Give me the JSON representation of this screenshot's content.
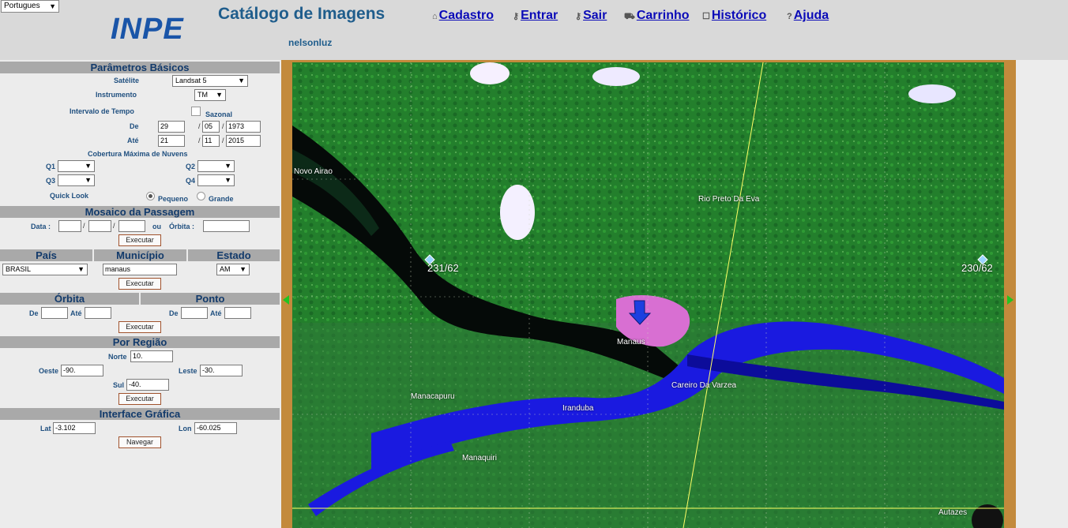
{
  "header": {
    "language": "Portugues",
    "logo": "INPE",
    "title": "Catálogo de Imagens",
    "user": "nelsonluz",
    "nav": [
      "Cadastro",
      "Entrar",
      "Sair",
      "Carrinho",
      "Histórico",
      "Ajuda"
    ]
  },
  "basic": {
    "title": "Parâmetros Básicos",
    "satellite_label": "Satélite",
    "satellite_value": "Landsat 5",
    "instrument_label": "Instrumento",
    "instrument_value": "TM",
    "interval_label": "Intervalo de Tempo",
    "seasonal_label": "Sazonal",
    "from_label": "De",
    "from_day": "29",
    "from_month": "05",
    "from_year": "1973",
    "to_label": "Até",
    "to_day": "21",
    "to_month": "11",
    "to_year": "2015",
    "clouds_label": "Cobertura Máxima de Nuvens",
    "q1": "Q1",
    "q2": "Q2",
    "q3": "Q3",
    "q4": "Q4",
    "quicklook_label": "Quick Look",
    "small": "Pequeno",
    "large": "Grande"
  },
  "mosaic": {
    "title": "Mosaico da Passagem",
    "date_label": "Data :",
    "or_label": "ou",
    "orbit_label": "Órbita :",
    "execute": "Executar"
  },
  "location": {
    "country_label": "País",
    "city_label": "Município",
    "state_label": "Estado",
    "country_value": "BRASIL",
    "city_value": "manaus",
    "state_value": "AM",
    "execute": "Executar"
  },
  "orbit": {
    "orbit_label": "Órbita",
    "point_label": "Ponto",
    "from_label": "De",
    "to_label": "Até",
    "from2_label": "De",
    "to2_label": "Até",
    "execute": "Executar"
  },
  "region": {
    "title": "Por Região",
    "north_label": "Norte",
    "north_value": "10.",
    "west_label": "Oeste",
    "west_value": "-90.",
    "east_label": "Leste",
    "east_value": "-30.",
    "south_label": "Sul",
    "south_value": "-40.",
    "execute": "Executar"
  },
  "graphic": {
    "title": "Interface Gráfica",
    "lat_label": "Lat",
    "lat_value": "-3.102",
    "lon_label": "Lon",
    "lon_value": "-60.025",
    "navigate": "Navegar"
  },
  "map": {
    "labels": [
      "Novo Airao",
      "231/62",
      "Rio Preto Da Eva",
      "230/62",
      "Manaus",
      "Careiro Da Varzea",
      "Manacapuru",
      "Iranduba",
      "Manaquiri",
      "Autazes"
    ]
  }
}
